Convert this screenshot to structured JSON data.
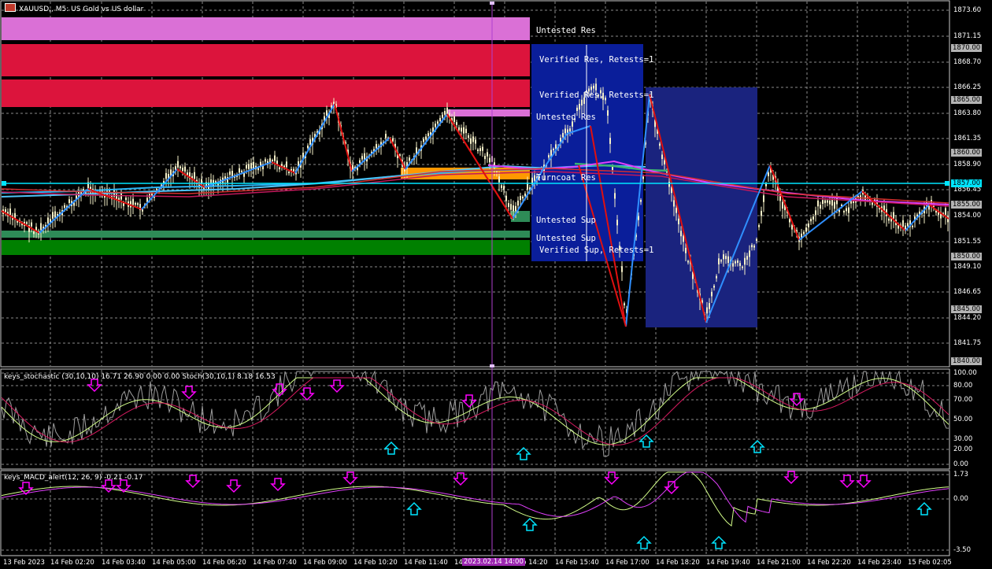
{
  "window": {
    "title": "XAUUSD,, M5:  US Gold vs US dollar",
    "icon": "chart-window-icon"
  },
  "zones_labels": [
    "Untested Res",
    "Verified Res, Retests=1",
    "Verified Res, Retests=1",
    "Untested Res",
    "Turncoat Res",
    "Untested Sup",
    "Untested Sup",
    "Verified Sup, Retests=1"
  ],
  "price_axis": {
    "ticks": [
      "1873.60",
      "1871.15",
      "1868.70",
      "1866.25",
      "1863.80",
      "1861.35",
      "1858.90",
      "1856.45",
      "1854.00",
      "1851.55",
      "1849.10",
      "1846.65",
      "1844.20",
      "1841.75"
    ],
    "tags": [
      "1870.00",
      "1865.00",
      "1860.00",
      "1857.00",
      "1855.00",
      "1850.00",
      "1845.00",
      "1840.00"
    ],
    "current_price": "1857.00"
  },
  "stochastic": {
    "title": "keys_stochastic (30,10,10) 16.71 26.90 0.00 0.00 Stoch(30,10,1) 8.18 16.53",
    "levels": [
      "100.00",
      "80.00",
      "70.00",
      "50.00",
      "30.00",
      "20.00",
      "0.00"
    ]
  },
  "macd": {
    "title": "keys_MACD_alert(12, 26, 9) -0.21 -0.17",
    "levels": [
      "1.73",
      "0.00",
      "-3.50"
    ]
  },
  "time_axis": {
    "labels": [
      "13 Feb 2023",
      "14 Feb 02:20",
      "14 Feb 03:40",
      "14 Feb 05:00",
      "14 Feb 06:20",
      "14 Feb 07:40",
      "14 Feb 09:00",
      "14 Feb 10:20",
      "14 Feb 11:40",
      "14 Feb",
      "b 14:20",
      "14 Feb 15:40",
      "14 Feb 17:00",
      "14 Feb 18:20",
      "14 Feb 19:40",
      "14 Feb 21:00",
      "14 Feb 22:20",
      "14 Feb 23:40",
      "15 Feb 02:05"
    ],
    "cursor_time": "2023.02.14 14:00"
  },
  "colors": {
    "background": "#000000",
    "bull_candle": "#f5f0c8",
    "zigzag_up": "#2f8fff",
    "zigzag_down": "#e01010",
    "current_price_line": "#00e5ff",
    "res_untested": "#da70d6",
    "res_verified": "#dc143c",
    "sup_untested": "#2e8b57",
    "sup_verified": "#008000",
    "turncoat": "#ff9800",
    "blue_box": "#0a1e9a"
  }
}
